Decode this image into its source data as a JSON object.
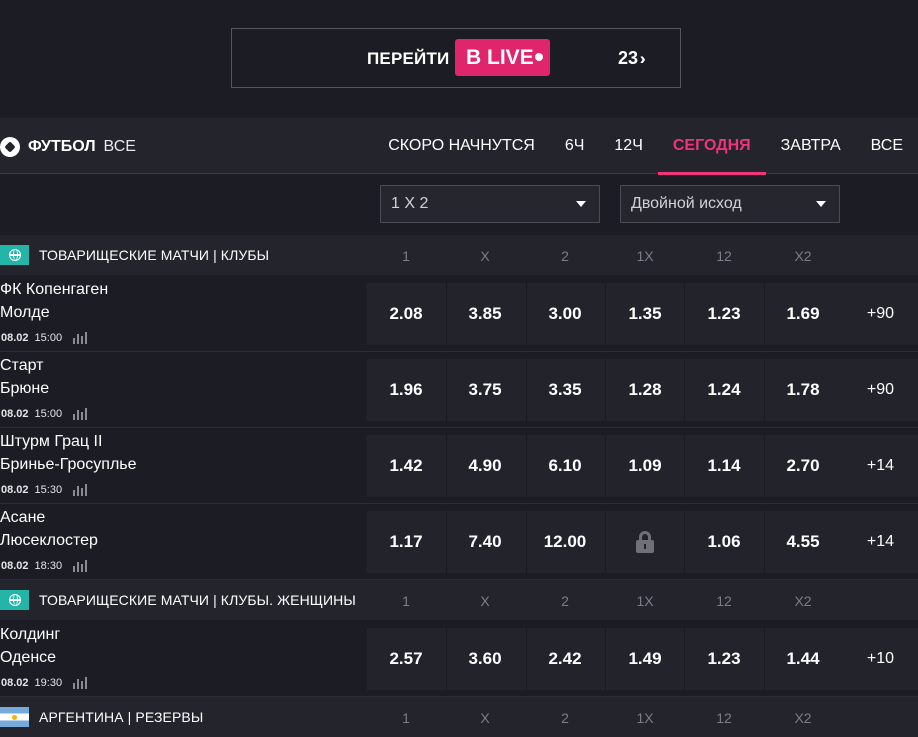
{
  "live_banner": {
    "goto_label": "ПЕРЕЙТИ",
    "live_label": "В LIVE",
    "live_count": "23"
  },
  "sport": {
    "name": "ФУТБОЛ",
    "all_label": "ВСЕ"
  },
  "tabs": [
    {
      "label": "СКОРО НАЧНУТСЯ",
      "active": false
    },
    {
      "label": "6Ч",
      "active": false
    },
    {
      "label": "12Ч",
      "active": false
    },
    {
      "label": "СЕГОДНЯ",
      "active": true
    },
    {
      "label": "ЗАВТРА",
      "active": false
    },
    {
      "label": "ВСЕ",
      "active": false
    }
  ],
  "selects": {
    "market1": "1 X 2",
    "market2": "Двойной исход"
  },
  "col_headers": [
    "1",
    "X",
    "2",
    "1X",
    "12",
    "X2"
  ],
  "leagues": [
    {
      "name": "ТОВАРИЩЕСКИЕ МАТЧИ | КЛУБЫ",
      "icon": "globe-icon",
      "matches": [
        {
          "team1": "ФК Копенгаген",
          "team2": "Молде",
          "date": "08.02",
          "time": "15:00",
          "odds": [
            "2.08",
            "3.85",
            "3.00",
            "1.35",
            "1.23",
            "1.69"
          ],
          "more": "+90"
        },
        {
          "team1": "Старт",
          "team2": "Брюне",
          "date": "08.02",
          "time": "15:00",
          "odds": [
            "1.96",
            "3.75",
            "3.35",
            "1.28",
            "1.24",
            "1.78"
          ],
          "more": "+90"
        },
        {
          "team1": "Штурм Грац II",
          "team2": "Бринье-Гросуплье",
          "date": "08.02",
          "time": "15:30",
          "odds": [
            "1.42",
            "4.90",
            "6.10",
            "1.09",
            "1.14",
            "2.70"
          ],
          "more": "+14"
        },
        {
          "team1": "Асане",
          "team2": "Люсеклостер",
          "date": "08.02",
          "time": "18:30",
          "odds": [
            "1.17",
            "7.40",
            "12.00",
            "locked",
            "1.06",
            "4.55"
          ],
          "more": "+14"
        }
      ]
    },
    {
      "name": "ТОВАРИЩЕСКИЕ МАТЧИ | КЛУБЫ. ЖЕНЩИНЫ",
      "icon": "globe-icon",
      "matches": [
        {
          "team1": "Колдинг",
          "team2": "Оденсе",
          "date": "08.02",
          "time": "19:30",
          "odds": [
            "2.57",
            "3.60",
            "2.42",
            "1.49",
            "1.23",
            "1.44"
          ],
          "more": "+10"
        }
      ]
    },
    {
      "name": "АРГЕНТИНА | РЕЗЕРВЫ",
      "icon": "argentina-flag-icon",
      "matches": []
    }
  ],
  "colors": {
    "accent": "#e0256d",
    "active_tab": "#f0337a",
    "league_icon": "#25b4a8",
    "background": "#1c1d24"
  }
}
